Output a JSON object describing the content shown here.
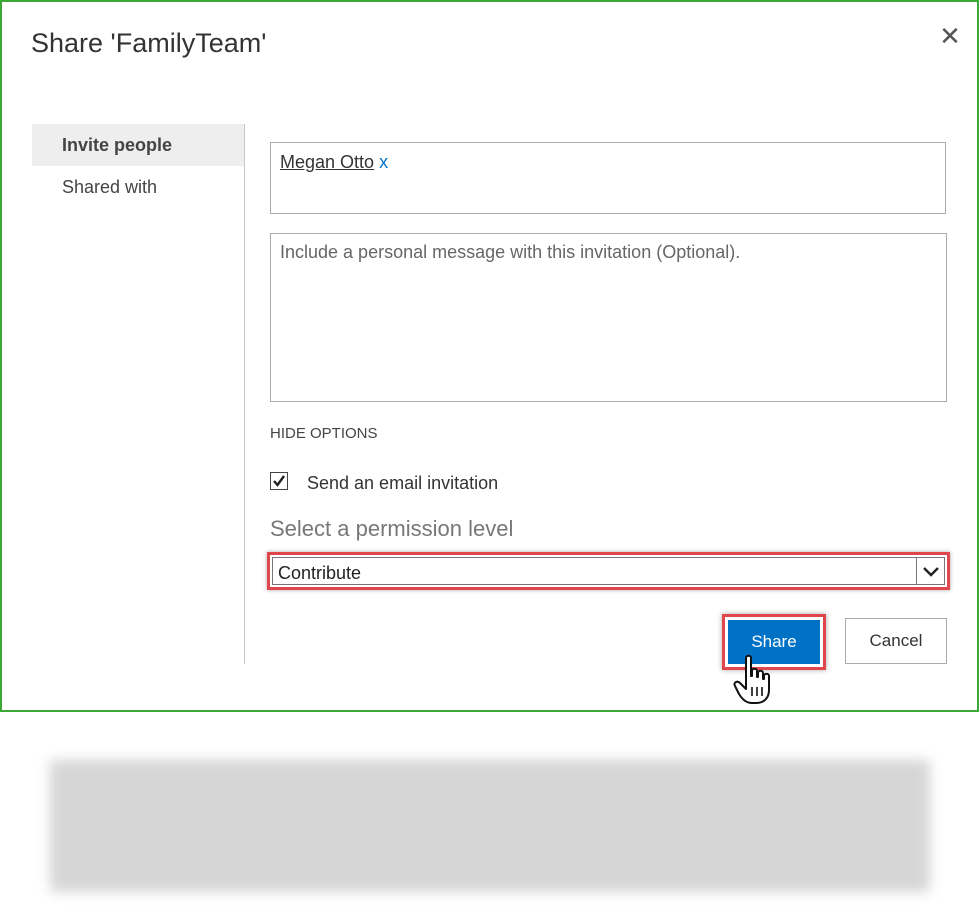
{
  "dialog": {
    "title": "Share 'FamilyTeam'",
    "close_icon": "close-icon",
    "border_color": "#3aa935"
  },
  "nav": {
    "items": [
      {
        "label": "Invite people",
        "active": true
      },
      {
        "label": "Shared with",
        "active": false
      }
    ]
  },
  "invite": {
    "person_name": "Megan Otto",
    "remove_label": "x",
    "message_placeholder": "Include a personal message with this invitation (Optional).",
    "hide_options_label": "HIDE OPTIONS",
    "send_email_label": "Send an email invitation",
    "send_email_checked": true,
    "permission_label": "Select a permission level",
    "permission_value": "Contribute"
  },
  "buttons": {
    "share_label": "Share",
    "cancel_label": "Cancel"
  },
  "colors": {
    "accent": "#0072c6",
    "highlight": "#e0474c"
  }
}
